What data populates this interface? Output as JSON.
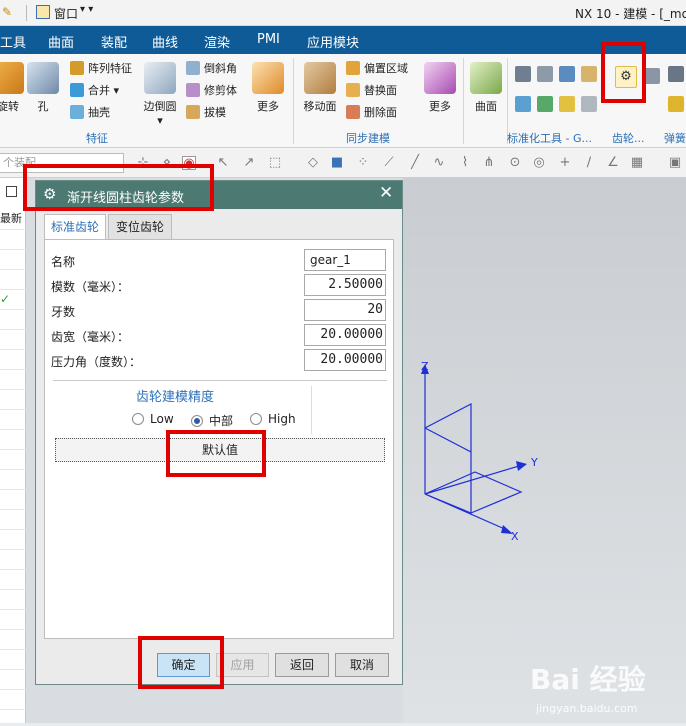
{
  "titlebar": {
    "window_menu": "窗口",
    "app_title": "NX 10 - 建模 - [_mo"
  },
  "menubar": {
    "items": [
      "工具",
      "曲面",
      "装配",
      "曲线",
      "渲染",
      "PMI",
      "应用模块"
    ]
  },
  "ribbon": {
    "buttons": {
      "b0": "旋转",
      "b1": "孔",
      "b2": "边倒圆",
      "b3": "更多",
      "b4": "移动面",
      "b5": "更多",
      "b6": "曲面"
    },
    "small": {
      "s0": "阵列特征",
      "s1": "合并",
      "s2": "抽壳",
      "s3": "倒斜角",
      "s4": "修剪体",
      "s5": "拔模",
      "s6": "偏置区域",
      "s7": "替换面",
      "s8": "删除面"
    },
    "groups": {
      "g0": "特征",
      "g1": "同步建模",
      "g2": "标准化工具 - G...",
      "g3": "齿轮...",
      "g4": "弹簧"
    }
  },
  "toolbar": {
    "filter_placeholder": "个装配"
  },
  "left_nav": {
    "header": "最新"
  },
  "dialog": {
    "title": "渐开线圆柱齿轮参数",
    "tabs": [
      "标准齿轮",
      "变位齿轮"
    ],
    "fields": [
      {
        "label": "名称",
        "value": "gear_1"
      },
      {
        "label": "模数（毫米）：",
        "value": "2.50000"
      },
      {
        "label": "牙数",
        "value": "20"
      },
      {
        "label": "齿宽（毫米）：",
        "value": "20.00000"
      },
      {
        "label": "压力角（度数）：",
        "value": "20.00000"
      }
    ],
    "precision": {
      "title": "齿轮建模精度",
      "options": [
        "Low",
        "中部",
        "High"
      ],
      "selected": "中部"
    },
    "default_button": "默认值",
    "buttons": {
      "ok": "确定",
      "apply": "应用",
      "back": "返回",
      "cancel": "取消"
    }
  },
  "axes": {
    "x": "X",
    "y": "Y",
    "z": "Z",
    "color": "#1f2fd6"
  },
  "watermark": {
    "logo": "Bai 经验",
    "url": "jingyan.baidu.com"
  },
  "colors": {
    "menubar": "#0f5b97",
    "dialog_title": "#4c7a72",
    "highlight": "#e00000",
    "accent": "#2e72b8"
  }
}
